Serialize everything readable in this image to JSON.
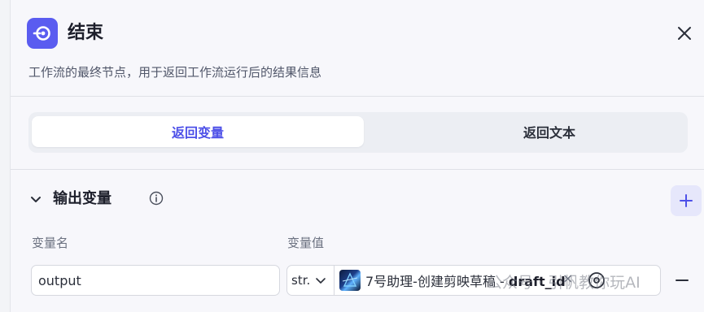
{
  "header": {
    "title": "结束",
    "description": "工作流的最终节点，用于返回工作流运行后的结果信息",
    "icon": "end-node-icon",
    "accent_color": "#5a5cf0"
  },
  "tabs": [
    {
      "label": "返回变量",
      "active": true
    },
    {
      "label": "返回文本",
      "active": false
    }
  ],
  "output_section": {
    "title": "输出变量",
    "columns": {
      "name": "变量名",
      "value": "变量值"
    },
    "rows": [
      {
        "name": "output",
        "type": "str.",
        "ref_node": "7号助理-创建剪映草稿 - ",
        "ref_field": "draft_id",
        "clear_label": "×"
      }
    ],
    "add_label": "+",
    "remove_label": "−"
  },
  "watermark": "公众号 · 引帆教你玩AI"
}
